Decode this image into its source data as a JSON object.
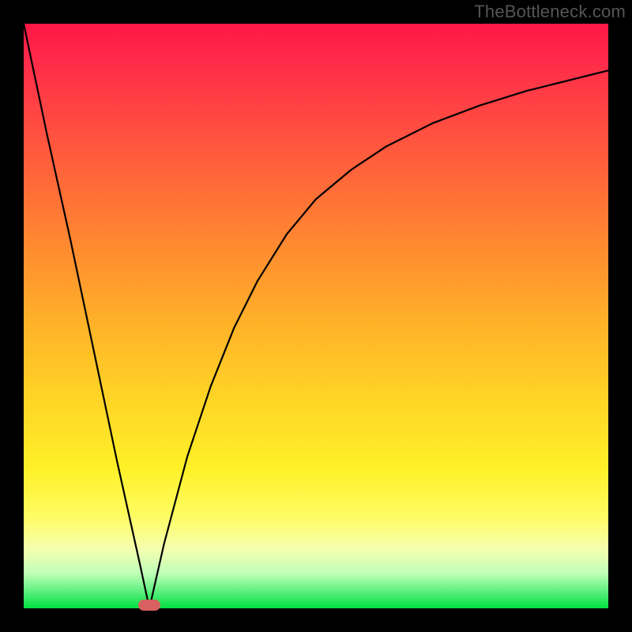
{
  "watermark": "TheBottleneck.com",
  "colors": {
    "curve": "#000000",
    "marker": "#d86060",
    "frame": "#000000"
  },
  "chart_data": {
    "type": "line",
    "title": "",
    "xlabel": "",
    "ylabel": "",
    "xlim": [
      0,
      100
    ],
    "ylim": [
      0,
      100
    ],
    "grid": false,
    "legend": false,
    "series": [
      {
        "name": "left-branch",
        "x": [
          0,
          4,
          8,
          12,
          16,
          18,
          20,
          21.5
        ],
        "values": [
          100,
          81,
          63,
          44,
          25,
          16,
          7,
          0
        ]
      },
      {
        "name": "right-branch",
        "x": [
          21.5,
          24,
          28,
          32,
          36,
          40,
          45,
          50,
          56,
          62,
          70,
          78,
          86,
          94,
          100
        ],
        "values": [
          0,
          11,
          26,
          38,
          48,
          56,
          64,
          70,
          75,
          79,
          83,
          86,
          88.5,
          90.5,
          92
        ]
      }
    ],
    "annotations": [
      {
        "name": "minimum-marker",
        "x": 21.5,
        "y": 0.5
      }
    ],
    "gradient_stops": [
      {
        "pos": 0.0,
        "color": "#ff1744"
      },
      {
        "pos": 0.4,
        "color": "#ff8a30"
      },
      {
        "pos": 0.75,
        "color": "#fff028"
      },
      {
        "pos": 0.95,
        "color": "#b0ffb0"
      },
      {
        "pos": 1.0,
        "color": "#00e040"
      }
    ]
  }
}
